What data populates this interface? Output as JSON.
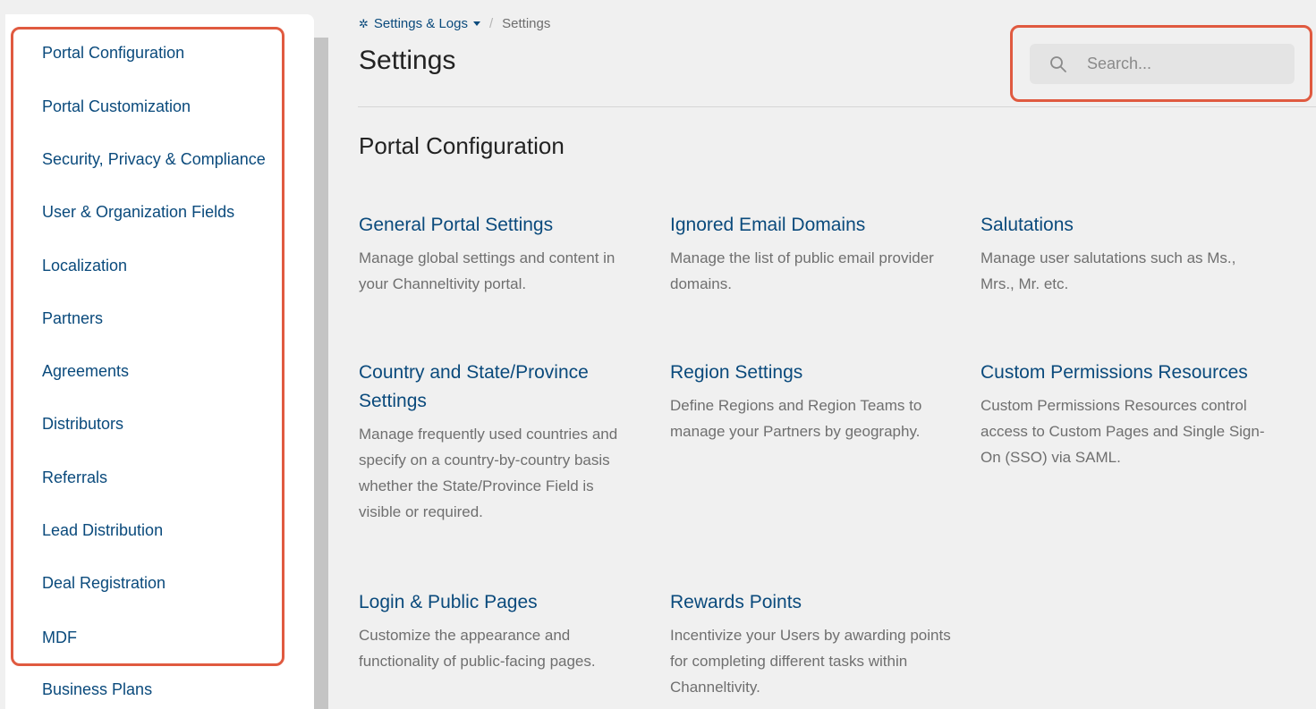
{
  "breadcrumb": {
    "parent": "Settings & Logs",
    "current": "Settings",
    "separator": "/"
  },
  "page_title": "Settings",
  "search": {
    "placeholder": "Search...",
    "value": ""
  },
  "sidebar": {
    "items": [
      {
        "label": "Portal Configuration"
      },
      {
        "label": "Portal Customization"
      },
      {
        "label": "Security, Privacy & Compliance"
      },
      {
        "label": "User & Organization Fields"
      },
      {
        "label": "Localization"
      },
      {
        "label": "Partners"
      },
      {
        "label": "Agreements"
      },
      {
        "label": "Distributors"
      },
      {
        "label": "Referrals"
      },
      {
        "label": "Lead Distribution"
      },
      {
        "label": "Deal Registration"
      },
      {
        "label": "MDF"
      },
      {
        "label": "Business Plans"
      }
    ]
  },
  "section": {
    "title": "Portal Configuration",
    "cards": [
      {
        "title": "General Portal Settings",
        "description": "Manage global settings and content in your Channeltivity portal."
      },
      {
        "title": "Ignored Email Domains",
        "description": "Manage the list of public email provider domains."
      },
      {
        "title": "Salutations",
        "description": "Manage user salutations such as Ms., Mrs., Mr. etc."
      },
      {
        "title": "Country and State/Province Settings",
        "description": "Manage frequently used countries and specify on a country-by-country basis whether the State/Province Field is visible or required."
      },
      {
        "title": "Region Settings",
        "description": "Define Regions and Region Teams to manage your Partners by geography."
      },
      {
        "title": "Custom Permissions Resources",
        "description": "Custom Permissions Resources control access to Custom Pages and Single Sign-On (SSO) via SAML."
      },
      {
        "title": "Login & Public Pages",
        "description": "Customize the appearance and functionality of public-facing pages."
      },
      {
        "title": "Rewards Points",
        "description": "Incentivize your Users by awarding points for completing different tasks within Channeltivity."
      }
    ]
  },
  "colors": {
    "link": "#0a4a7c",
    "highlight": "#e05a40",
    "background": "#f0f0f0",
    "description": "#6f6f6f"
  }
}
